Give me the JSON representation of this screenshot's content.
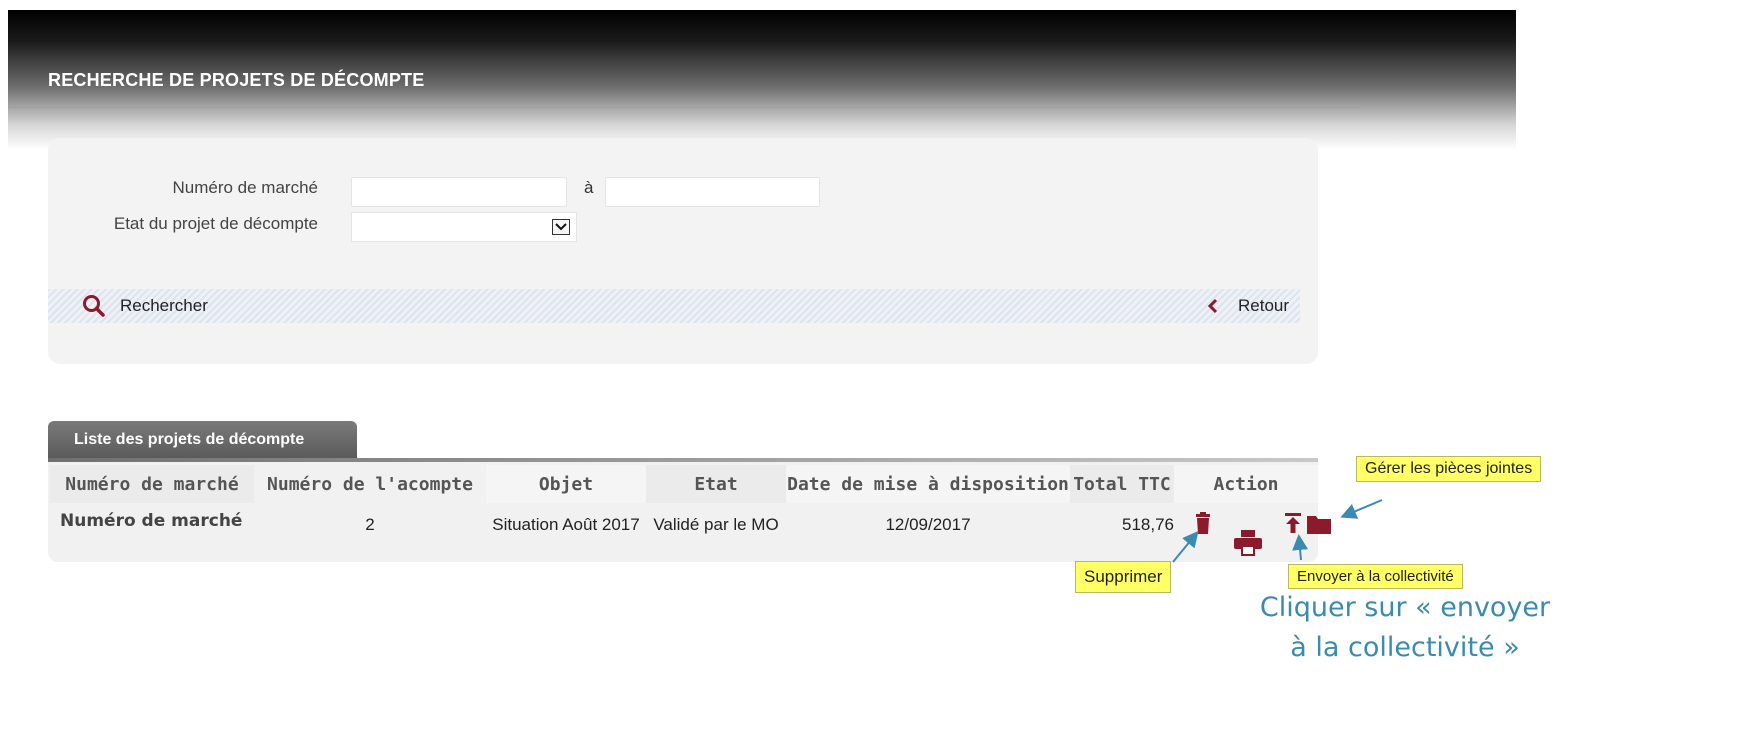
{
  "header": {
    "title": "RECHERCHE DE PROJETS DE DÉCOMPTE"
  },
  "search": {
    "numero_marche_label": "Numéro de marché",
    "range_separator": "à",
    "etat_label": "Etat du projet de décompte",
    "etat_selected": "",
    "numero_from_value": "",
    "numero_to_value": "",
    "search_button": "Rechercher",
    "back_button": "Retour"
  },
  "list": {
    "tab_label": "Liste des projets de décompte",
    "columns": [
      "Numéro de marché",
      "Numéro de l'acompte",
      "Objet",
      "Etat",
      "Date de mise à disposition",
      "Total TTC",
      "Action"
    ],
    "rows": [
      {
        "numero_marche": "Numéro de marché",
        "numero_acompte": "2",
        "objet": "Situation Août 2017",
        "etat": "Validé par le MO",
        "date": "12/09/2017",
        "total": "518,76"
      }
    ]
  },
  "icons": {
    "search": "search-icon",
    "back": "chevron-left-icon",
    "delete": "trash-icon",
    "print": "printer-icon",
    "send": "upload-icon",
    "attachments": "folder-icon"
  },
  "annotations": {
    "tooltip_attachments": "Gérer les pièces jointes",
    "tooltip_delete": "Supprimer",
    "tooltip_send": "Envoyer à la collectivité",
    "callout_line1": "Cliquer sur « envoyer",
    "callout_line2": "à la collectivité »"
  },
  "colors": {
    "accent": "#8b1a2b",
    "callout": "#3b8bb0",
    "tooltip_bg": "#ffff66"
  }
}
